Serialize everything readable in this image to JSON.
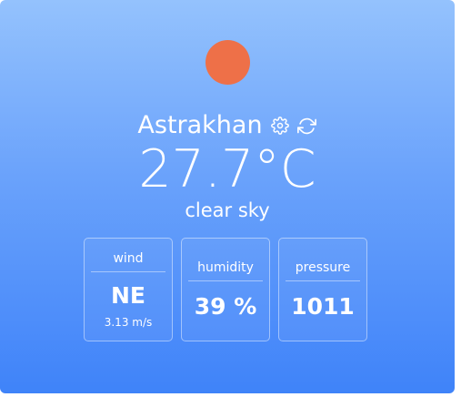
{
  "weather": {
    "city": "Astrakhan",
    "temperature": "27.7°C",
    "description": "clear sky",
    "sun_color": "#ee7048"
  },
  "icons": {
    "settings": "gear-icon",
    "refresh": "refresh-icon",
    "condition": "sun-icon"
  },
  "stats": {
    "wind": {
      "label": "wind",
      "value": "NE",
      "sub": "3.13 m/s"
    },
    "humidity": {
      "label": "humidity",
      "value": "39 %"
    },
    "pressure": {
      "label": "pressure",
      "value": "1011"
    }
  }
}
